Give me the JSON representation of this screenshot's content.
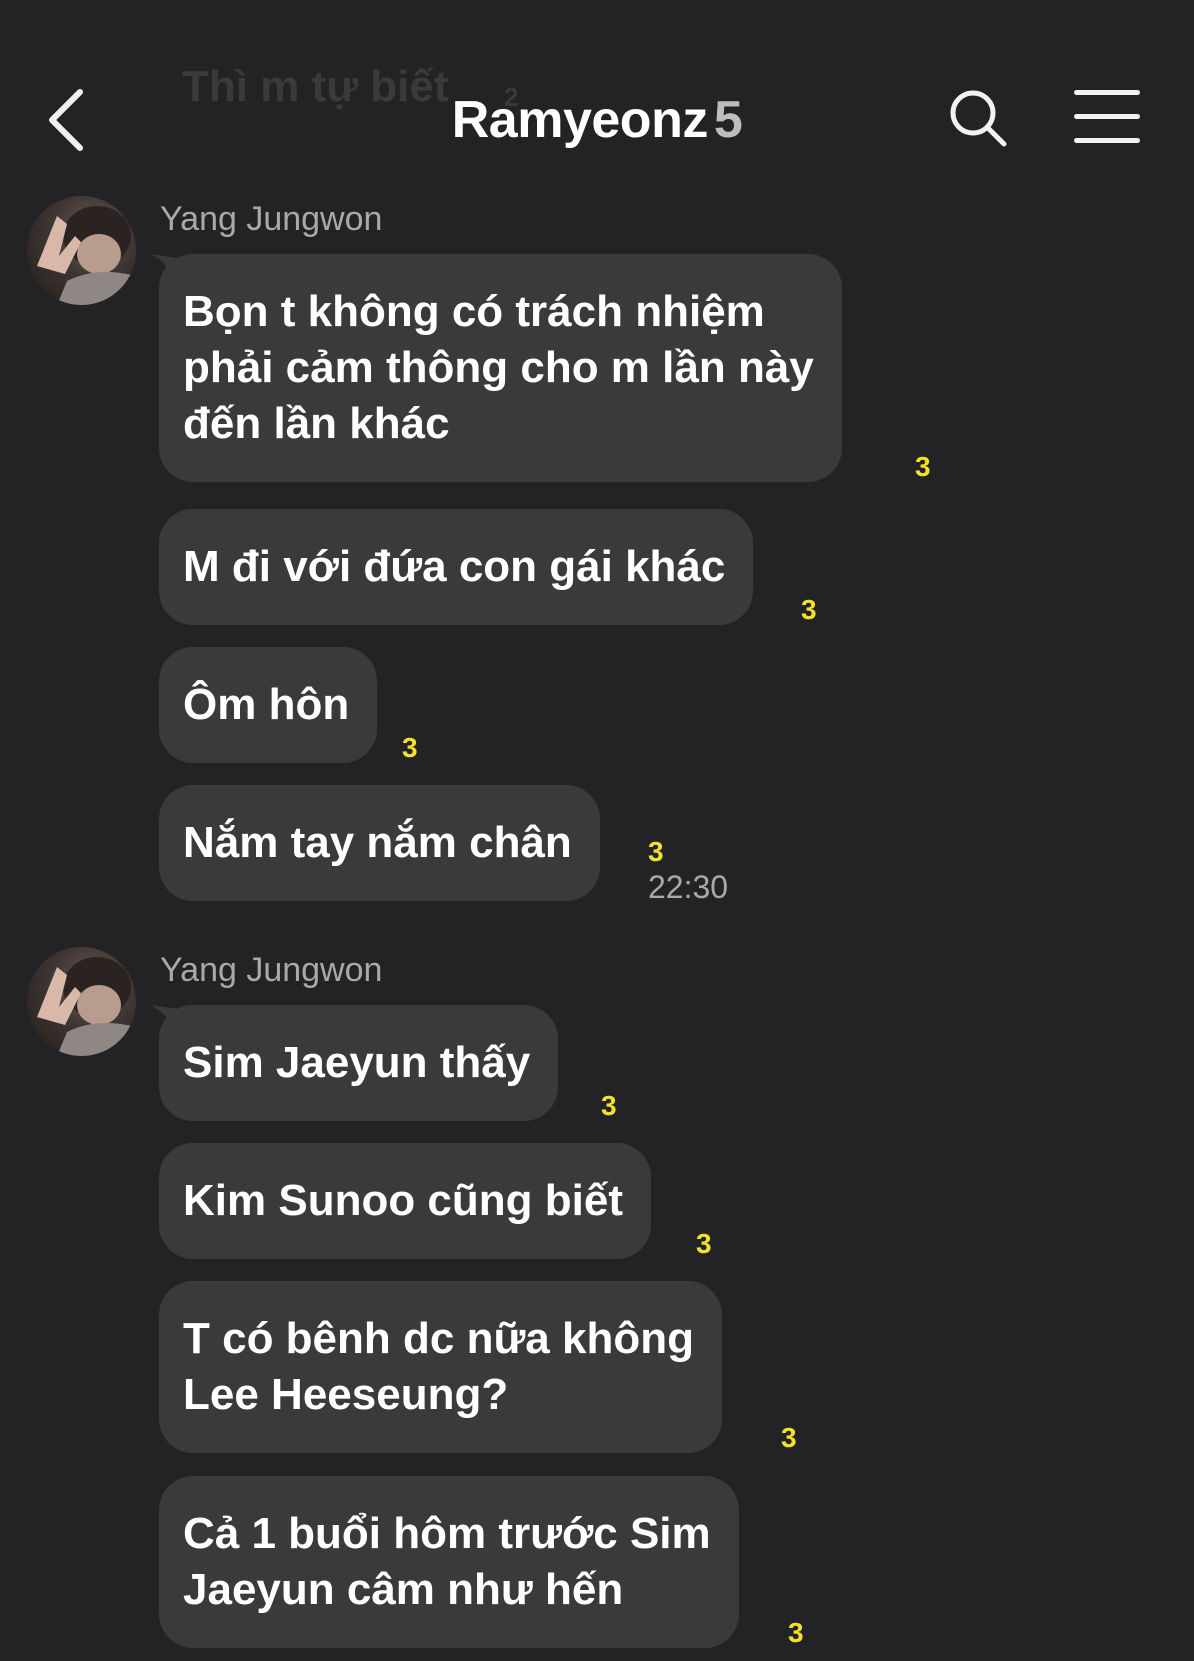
{
  "header": {
    "back_icon": "chevron-left-icon",
    "title": "Ramyeonz",
    "member_count": "5",
    "search_icon": "search-icon",
    "menu_icon": "hamburger-menu-icon"
  },
  "background_text": {
    "scrolled_message": "Thì m tự biết",
    "scrolled_unread": "2"
  },
  "groups": [
    {
      "sender": "Yang Jungwon",
      "messages": [
        {
          "lines": [
            "Bọn t không có trách nhiệm",
            "phải cảm thông cho m lần này",
            "đến lần khác"
          ],
          "unread": "3",
          "time": ""
        },
        {
          "lines": [
            "M đi với đứa con gái khác"
          ],
          "unread": "3",
          "time": ""
        },
        {
          "lines": [
            "Ôm hôn"
          ],
          "unread": "3",
          "time": ""
        },
        {
          "lines": [
            "Nắm tay nắm chân"
          ],
          "unread": "3",
          "time": "22:30"
        }
      ]
    },
    {
      "sender": "Yang Jungwon",
      "messages": [
        {
          "lines": [
            "Sim Jaeyun thấy"
          ],
          "unread": "3",
          "time": ""
        },
        {
          "lines": [
            "Kim Sunoo cũng biết"
          ],
          "unread": "3",
          "time": ""
        },
        {
          "lines": [
            "T có bênh dc nữa không",
            "Lee Heeseung?"
          ],
          "unread": "3",
          "time": ""
        },
        {
          "lines": [
            "Cả 1 buổi hôm trước Sim",
            "Jaeyun câm như hến"
          ],
          "unread": "3",
          "time": ""
        }
      ]
    }
  ],
  "colors": {
    "background": "#232325",
    "bubble": "#3a3a3c",
    "unread": "#f5e12a",
    "secondary_text": "#a9a9ab"
  }
}
